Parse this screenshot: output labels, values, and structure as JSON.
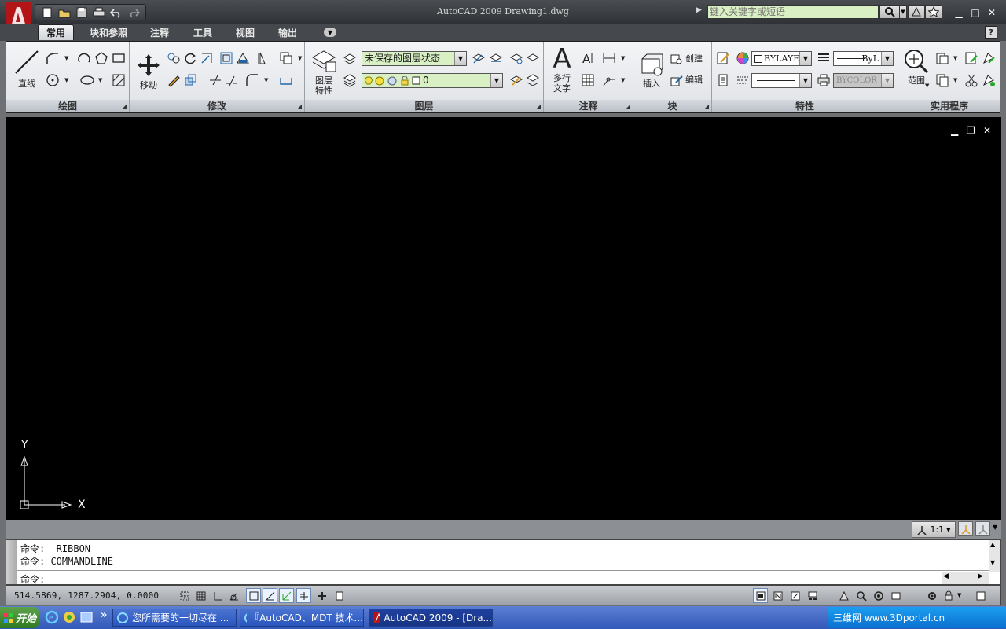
{
  "window": {
    "title": "AutoCAD 2009  Drawing1.dwg"
  },
  "search": {
    "placeholder": "键入关键字或短语"
  },
  "tabs": [
    {
      "label": "常用",
      "active": true
    },
    {
      "label": "块和参照",
      "active": false
    },
    {
      "label": "注释",
      "active": false
    },
    {
      "label": "工具",
      "active": false
    },
    {
      "label": "视图",
      "active": false
    },
    {
      "label": "输出",
      "active": false
    }
  ],
  "ribbon": {
    "draw": {
      "title": "绘图",
      "line_label": "直线"
    },
    "modify": {
      "title": "修改",
      "move_label": "移动"
    },
    "layers": {
      "title": "图层",
      "properties_label1": "图层",
      "properties_label2": "特性",
      "state_combo": "未保存的图层状态",
      "layer_combo": "0"
    },
    "annotation": {
      "title": "注释",
      "mtext_label1": "多行",
      "mtext_label2": "文字",
      "mtext_glyph": "A"
    },
    "block": {
      "title": "块",
      "insert_label": "插入",
      "create_label": "创建",
      "edit_label": "编辑"
    },
    "properties": {
      "title": "特性",
      "color_combo": "BYLAYER",
      "linetype_combo": "ByL",
      "plotstyle_combo": "BYCOLOR"
    },
    "utilities": {
      "title": "实用程序",
      "range_label": "范围"
    }
  },
  "ucs": {
    "y_label": "Y",
    "x_label": "X"
  },
  "model_bar": {
    "anno_scale": "1:1"
  },
  "command": {
    "history": [
      "命令: _RIBBON",
      "命令: COMMANDLINE"
    ],
    "prompt": "命令:"
  },
  "status": {
    "coords": "514.5869,   1287.2904,  0.0000"
  },
  "taskbar": {
    "start_label": "开始",
    "chevron": "»",
    "tasks": [
      {
        "label": "您所需要的一切尽在 ..."
      },
      {
        "label": "『AutoCAD、MDT 技术..."
      },
      {
        "label": "AutoCAD 2009 - [Dra..."
      }
    ],
    "tray_text": "三维网 www.3Dportal.cn"
  },
  "colors": {
    "viewport": "#000000",
    "accent": "#d9efc4",
    "taskbar": "#3259b8"
  }
}
